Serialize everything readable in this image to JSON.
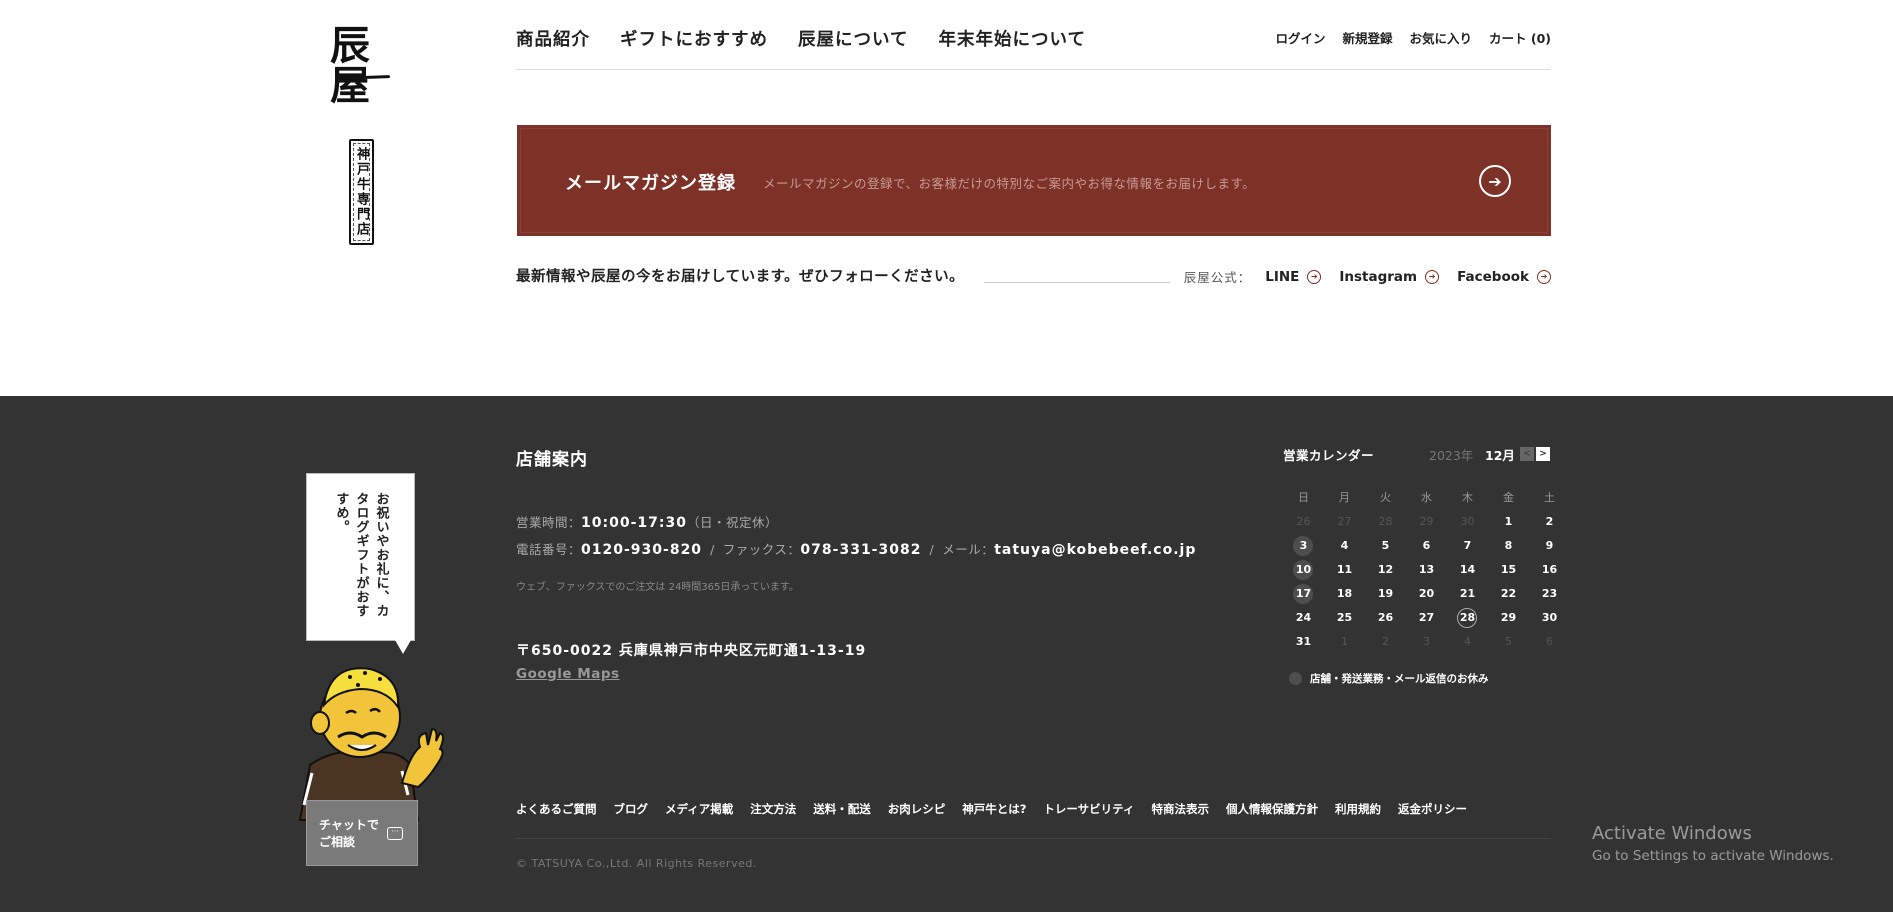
{
  "logo": {
    "text": "辰屋"
  },
  "badge": {
    "text": "神戸牛専門店"
  },
  "global_nav": [
    "商品紹介",
    "ギフトにおすすめ",
    "辰屋について",
    "年末年始について"
  ],
  "user_nav": [
    "ログイン",
    "新規登録",
    "お気に入り",
    "カート (0)"
  ],
  "mail_magazine": {
    "title": "メールマガジン登録",
    "description": "メールマガジンの登録で、お客様だけの特別なご案内やお得な情報をお届けします。"
  },
  "follow": {
    "text": "最新情報や辰屋の今をお届けしています。ぜひフォローください。",
    "label": "辰屋公式：",
    "links": [
      "LINE",
      "Instagram",
      "Facebook"
    ]
  },
  "chat": {
    "bubble": "お祝いやお礼に、カタログギフトがおすすめ。",
    "button_line1": "チャットで",
    "button_line2": "ご相談"
  },
  "shop": {
    "title": "店舗案内",
    "hours_label": "営業時間：",
    "hours_value": "10:00-17:30",
    "hours_note": "（日・祝定休）",
    "tel_label": "電話番号：",
    "tel_value": "0120-930-820",
    "fax_label": "ファックス：",
    "fax_value": "078-331-3082",
    "mail_label": "メール：",
    "mail_value": "tatuya@kobebeef.co.jp",
    "note": "ウェブ、ファックスでのご注文は 24時間365日承っています。",
    "address": "〒650-0022 兵庫県神戸市中央区元町通1-13-19",
    "maps_link": "Google Maps"
  },
  "calendar": {
    "title": "営業カレンダー",
    "year": "2023年",
    "month": "12月",
    "prev": "<",
    "next": ">",
    "weekdays": [
      "日",
      "月",
      "火",
      "水",
      "木",
      "金",
      "土"
    ],
    "days": [
      {
        "d": "26",
        "s": "muted"
      },
      {
        "d": "27",
        "s": "muted"
      },
      {
        "d": "28",
        "s": "muted"
      },
      {
        "d": "29",
        "s": "muted"
      },
      {
        "d": "30",
        "s": "muted"
      },
      {
        "d": "1",
        "s": ""
      },
      {
        "d": "2",
        "s": ""
      },
      {
        "d": "3",
        "s": "hol"
      },
      {
        "d": "4",
        "s": ""
      },
      {
        "d": "5",
        "s": ""
      },
      {
        "d": "6",
        "s": ""
      },
      {
        "d": "7",
        "s": ""
      },
      {
        "d": "8",
        "s": ""
      },
      {
        "d": "9",
        "s": ""
      },
      {
        "d": "10",
        "s": "hol"
      },
      {
        "d": "11",
        "s": ""
      },
      {
        "d": "12",
        "s": ""
      },
      {
        "d": "13",
        "s": ""
      },
      {
        "d": "14",
        "s": ""
      },
      {
        "d": "15",
        "s": ""
      },
      {
        "d": "16",
        "s": ""
      },
      {
        "d": "17",
        "s": "hol"
      },
      {
        "d": "18",
        "s": ""
      },
      {
        "d": "19",
        "s": ""
      },
      {
        "d": "20",
        "s": ""
      },
      {
        "d": "21",
        "s": ""
      },
      {
        "d": "22",
        "s": ""
      },
      {
        "d": "23",
        "s": ""
      },
      {
        "d": "24",
        "s": ""
      },
      {
        "d": "25",
        "s": ""
      },
      {
        "d": "26",
        "s": ""
      },
      {
        "d": "27",
        "s": ""
      },
      {
        "d": "28",
        "s": "today"
      },
      {
        "d": "29",
        "s": ""
      },
      {
        "d": "30",
        "s": ""
      },
      {
        "d": "31",
        "s": ""
      },
      {
        "d": "1",
        "s": "muted"
      },
      {
        "d": "2",
        "s": "muted"
      },
      {
        "d": "3",
        "s": "muted"
      },
      {
        "d": "4",
        "s": "muted"
      },
      {
        "d": "5",
        "s": "muted"
      },
      {
        "d": "6",
        "s": "muted"
      }
    ],
    "legend": "店舗・発送業務・メール返信のお休み"
  },
  "footer_nav": [
    "よくあるご質問",
    "ブログ",
    "メディア掲載",
    "注文方法",
    "送料・配送",
    "お肉レシピ",
    "神戸牛とは?",
    "トレーサビリティ",
    "特商法表示",
    "個人情報保護方針",
    "利用規約",
    "返金ポリシー"
  ],
  "copyright": "© TATSUYA Co.,Ltd. All Rights Reserved.",
  "windows_watermark": {
    "title": "Activate Windows",
    "subtitle": "Go to Settings to activate Windows."
  },
  "colors": {
    "brand": "#7e3127",
    "footer_bg": "#333333",
    "text": "#222222"
  }
}
